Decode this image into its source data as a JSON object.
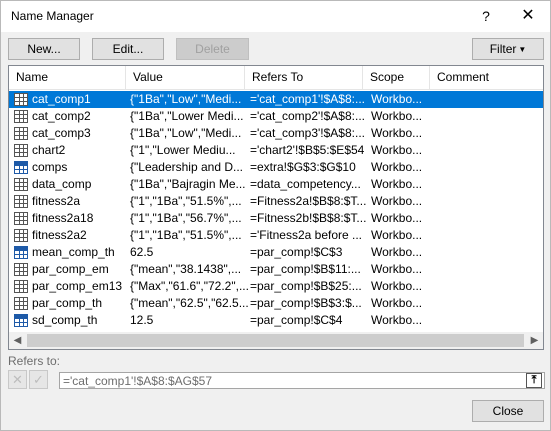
{
  "window": {
    "title": "Name Manager",
    "help": "?",
    "close": "✕"
  },
  "toolbar": {
    "new_label": "New...",
    "edit_label": "Edit...",
    "delete_label": "Delete",
    "filter_label": "Filter",
    "filter_caret": "▼"
  },
  "columns": [
    "Name",
    "Value",
    "Refers To",
    "Scope",
    "Comment"
  ],
  "rows": [
    {
      "name": "cat_comp1",
      "value": "{\"1Ba\",\"Low\",\"Medi...",
      "refers_to": "='cat_comp1'!$A$8:...",
      "scope": "Workbo...",
      "icon": "table-icon",
      "selected": true
    },
    {
      "name": "cat_comp2",
      "value": "{\"1Ba\",\"Lower Medi...",
      "refers_to": "='cat_comp2'!$A$8:...",
      "scope": "Workbo...",
      "icon": "table-icon"
    },
    {
      "name": "cat_comp3",
      "value": "{\"1Ba\",\"Low\",\"Medi...",
      "refers_to": "='cat_comp3'!$A$8:...",
      "scope": "Workbo...",
      "icon": "table-icon"
    },
    {
      "name": "chart2",
      "value": "{\"1\",\"Lower Mediu...",
      "refers_to": "='chart2'!$B$5:$E$54",
      "scope": "Workbo...",
      "icon": "table-icon"
    },
    {
      "name": "comps",
      "value": "{\"Leadership and D...",
      "refers_to": "=extra!$G$3:$G$10",
      "scope": "Workbo...",
      "icon": "named-range-icon"
    },
    {
      "name": "data_comp",
      "value": "{\"1Ba\",\"Bajragin Me...",
      "refers_to": "=data_competency...",
      "scope": "Workbo...",
      "icon": "table-icon"
    },
    {
      "name": "fitness2a",
      "value": "{\"1\",\"1Ba\",\"51.5%\",...",
      "refers_to": "=Fitness2a!$B$8:$T...",
      "scope": "Workbo...",
      "icon": "table-icon"
    },
    {
      "name": "fitness2a18",
      "value": "{\"1\",\"1Ba\",\"56.7%\",...",
      "refers_to": "=Fitness2b!$B$8:$T...",
      "scope": "Workbo...",
      "icon": "table-icon"
    },
    {
      "name": "fitness2a2",
      "value": "{\"1\",\"1Ba\",\"51.5%\",...",
      "refers_to": "='Fitness2a before ...",
      "scope": "Workbo...",
      "icon": "table-icon"
    },
    {
      "name": "mean_comp_th",
      "value": "62.5",
      "refers_to": "=par_comp!$C$3",
      "scope": "Workbo...",
      "icon": "named-range-icon"
    },
    {
      "name": "par_comp_em",
      "value": "{\"mean\",\"38.1438\",...",
      "refers_to": "=par_comp!$B$11:...",
      "scope": "Workbo...",
      "icon": "table-icon"
    },
    {
      "name": "par_comp_em13",
      "value": "{\"Max\",\"61.6\",\"72.2\",...",
      "refers_to": "=par_comp!$B$25:...",
      "scope": "Workbo...",
      "icon": "table-icon"
    },
    {
      "name": "par_comp_th",
      "value": "{\"mean\",\"62.5\",\"62.5...",
      "refers_to": "=par_comp!$B$3:$...",
      "scope": "Workbo...",
      "icon": "table-icon"
    },
    {
      "name": "sd_comp_th",
      "value": "12.5",
      "refers_to": "=par_comp!$C$4",
      "scope": "Workbo...",
      "icon": "named-range-icon"
    }
  ],
  "refers_to_section": {
    "label": "Refers to:",
    "value": "='cat_comp1'!$A$8:$AG$57",
    "cancel": "✕",
    "confirm": "✓",
    "collapse": "⤒"
  },
  "footer": {
    "close_label": "Close"
  }
}
